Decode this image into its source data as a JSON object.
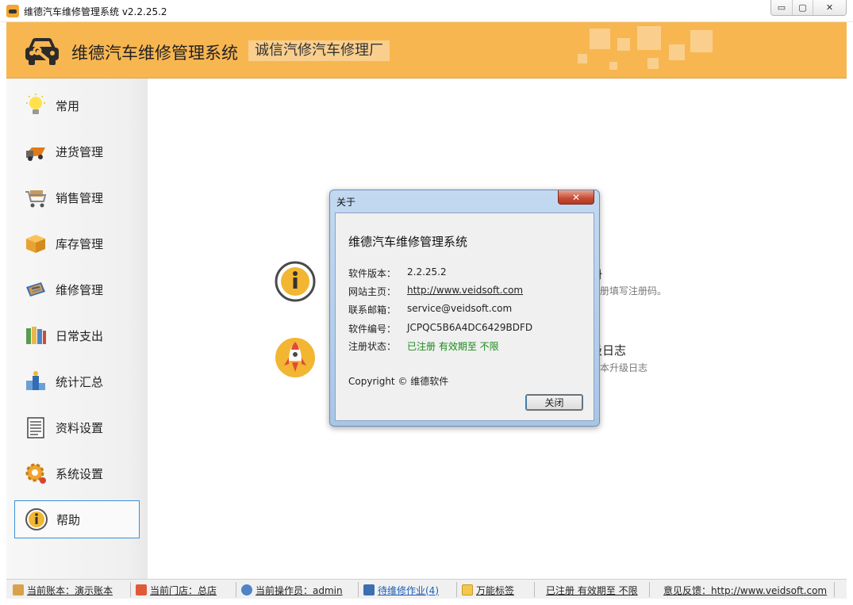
{
  "window": {
    "title": "维德汽车维修管理系统   v2.2.25.2",
    "minimize": "▭",
    "restore": "▢",
    "close": "✕"
  },
  "header": {
    "app_name": "维德汽车维修管理系统",
    "shop_name": "诚信汽修汽车修理厂"
  },
  "sidebar": {
    "items": [
      {
        "label": "常用",
        "icon": "lightbulb-icon"
      },
      {
        "label": "进货管理",
        "icon": "truck-icon"
      },
      {
        "label": "销售管理",
        "icon": "cart-icon"
      },
      {
        "label": "库存管理",
        "icon": "box-icon"
      },
      {
        "label": "维修管理",
        "icon": "toolbox-icon"
      },
      {
        "label": "日常支出",
        "icon": "binders-icon"
      },
      {
        "label": "统计汇总",
        "icon": "podium-icon"
      },
      {
        "label": "资料设置",
        "icon": "document-icon"
      },
      {
        "label": "系统设置",
        "icon": "gear-icon"
      },
      {
        "label": "帮助",
        "icon": "info-icon"
      }
    ],
    "active_index": 9
  },
  "main": {
    "cards": [
      {
        "title_partial": "册",
        "desc_partial": "注册填写注册码。"
      },
      {
        "title_partial": "级日志",
        "desc_partial": "版本升级日志"
      }
    ]
  },
  "dialog": {
    "title": "关于",
    "close_glyph": "✕",
    "heading": "维德汽车维修管理系统",
    "rows": [
      {
        "key": "软件版本：",
        "value": "2.2.25.2"
      },
      {
        "key": "网站主页：",
        "value": "http://www.veidsoft.com"
      },
      {
        "key": "联系邮箱：",
        "value": "service@veidsoft.com"
      },
      {
        "key": "软件编号：",
        "value": "JCPQC5B6A4DC6429BDFD"
      },
      {
        "key": "注册状态：",
        "value": "已注册  有效期至  不限"
      }
    ],
    "copyright": "Copyright © 维德软件",
    "close_button": "关闭",
    "colors": {
      "status_green": "#1a8a1a"
    }
  },
  "statusbar": {
    "account": "当前账本：演示账本",
    "store": "当前门店：总店",
    "operator": "当前操作员：admin",
    "pending": "待维修作业(4)",
    "labels": "万能标签",
    "registration": "已注册  有效期至  不限",
    "feedback": "意见反馈：http://www.veidsoft.com"
  },
  "colors": {
    "header_orange": "#f8b651",
    "active_border": "#3c8fd6",
    "link_blue": "#1d5fb8"
  }
}
